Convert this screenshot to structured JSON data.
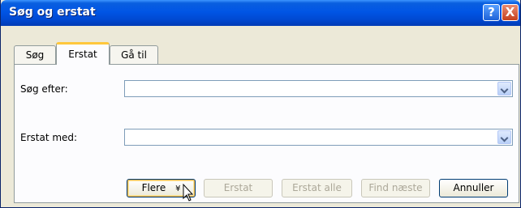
{
  "window": {
    "title": "Søg og erstat"
  },
  "titlebar_buttons": {
    "help": "?",
    "close": "X"
  },
  "tabs": [
    {
      "label": "Søg",
      "active": false
    },
    {
      "label": "Erstat",
      "active": true
    },
    {
      "label": "Gå til",
      "active": false
    }
  ],
  "fields": {
    "search_label": "Søg efter:",
    "search_value": "",
    "replace_label": "Erstat med:",
    "replace_value": ""
  },
  "buttons": {
    "more": "Flere",
    "more_arrow": "¥",
    "replace": "Erstat",
    "replace_all": "Erstat alle",
    "find_next": "Find næste",
    "cancel": "Annuller"
  }
}
